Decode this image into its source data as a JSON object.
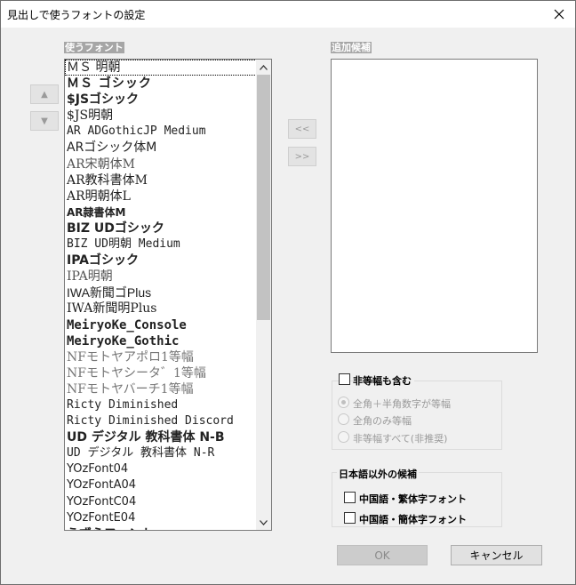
{
  "window": {
    "title": "見出しで使うフォントの設定"
  },
  "font_list": {
    "label": "使うフォント",
    "items": [
      "ＭＳ 明朝",
      "ＭＳ ゴシック",
      "$JSゴシック",
      "$JS明朝",
      "AR ADGothicJP Medium",
      "ARゴシック体M",
      "AR宋朝体M",
      "AR教科書体M",
      "AR明朝体L",
      "AR隷書体M",
      "BIZ UDゴシック",
      "BIZ UD明朝 Medium",
      "IPAゴシック",
      "IPA明朝",
      "IWA新聞ゴPlus",
      "IWA新聞明Plus",
      "MeiryoKe_Console",
      "MeiryoKe_Gothic",
      "NFモトヤアポロ1等幅",
      "NFモトヤシータ゛1等幅",
      "NFモトヤバーチ1等幅",
      "Ricty Diminished",
      "Ricty Diminished Discord",
      "UD デジタル 教科書体 N-B",
      "UD デジタル 教科書体 N-R",
      "YOzFont04",
      "YOzFontA04",
      "YOzFontC04",
      "YOzFontE04",
      "うずらフォント"
    ],
    "selected_index": 0
  },
  "candidates": {
    "label": "追加候補",
    "items": []
  },
  "arrows": {
    "up": "▲",
    "down": "▼",
    "add": "<<",
    "remove": ">>"
  },
  "width_options": {
    "checkbox_label": "非等幅も含む",
    "radios": [
      "全角＋半角数字が等幅",
      "全角のみ等幅",
      "非等幅すべて(非推奨)"
    ],
    "selected_radio": 0
  },
  "non_japanese": {
    "legend": "日本語以外の候補",
    "options": [
      "中国語・繁体字フォント",
      "中国語・簡体字フォント"
    ]
  },
  "buttons": {
    "ok": "OK",
    "cancel": "キャンセル"
  },
  "icons": {
    "close": "close-icon",
    "scroll_up": "chevron-up-icon",
    "scroll_down": "chevron-down-icon"
  }
}
